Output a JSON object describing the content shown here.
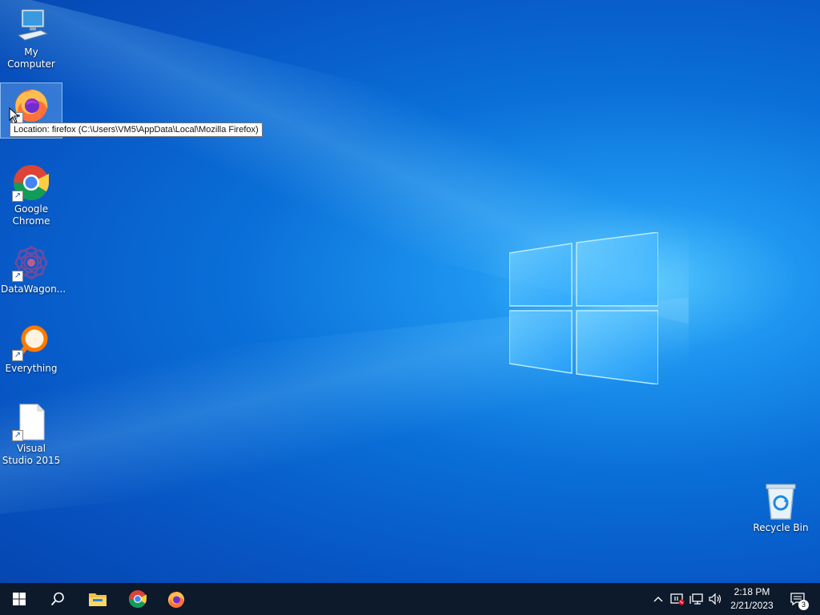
{
  "desktop": {
    "icons": [
      {
        "label": "My Computer"
      },
      {
        "label": ""
      },
      {
        "label": "Google Chrome"
      },
      {
        "label": "DataWagon..."
      },
      {
        "label": "Everything"
      },
      {
        "label": "Visual Studio 2015"
      },
      {
        "label": "Recycle Bin"
      }
    ],
    "tooltip": "Location: firefox (C:\\Users\\VM5\\AppData\\Local\\Mozilla Firefox)"
  },
  "taskbar": {
    "pinned": [
      "start-icon",
      "search-icon",
      "file-explorer-icon",
      "chrome-icon",
      "firefox-icon"
    ],
    "tray": {
      "time": "2:18 PM",
      "date": "2/21/2023",
      "notification_count": "3"
    }
  },
  "colors": {
    "taskbar_bg": "#0c1a2b",
    "desktop_accent": "#0a6fd8"
  }
}
